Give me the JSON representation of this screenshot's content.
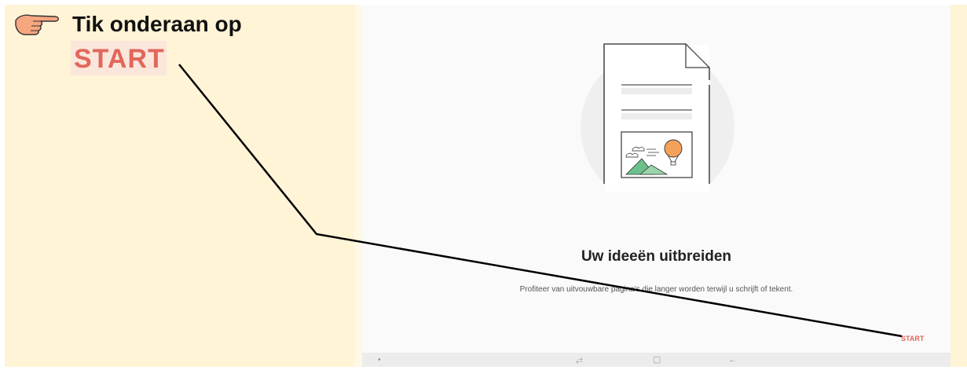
{
  "instruction": {
    "text": "Tik onderaan op",
    "highlight": "START"
  },
  "app": {
    "title": "Uw ideeën uitbreiden",
    "description": "Profiteer van uitvouwbare pagina's die langer worden terwijl u schrijft of tekent.",
    "start_label": "START"
  },
  "navbar": {
    "icons": [
      "dot-icon",
      "recent-apps-icon",
      "home-icon",
      "back-icon"
    ],
    "glyphs": {
      "dot": "•",
      "recent": "⥄",
      "home": "▢",
      "back": "←"
    }
  },
  "colors": {
    "panel_bg": "#fff4d6",
    "accent": "#e2675b",
    "app_bg": "#fafafa",
    "balloon": "#f4a259",
    "mountain": "#6cc08b"
  }
}
